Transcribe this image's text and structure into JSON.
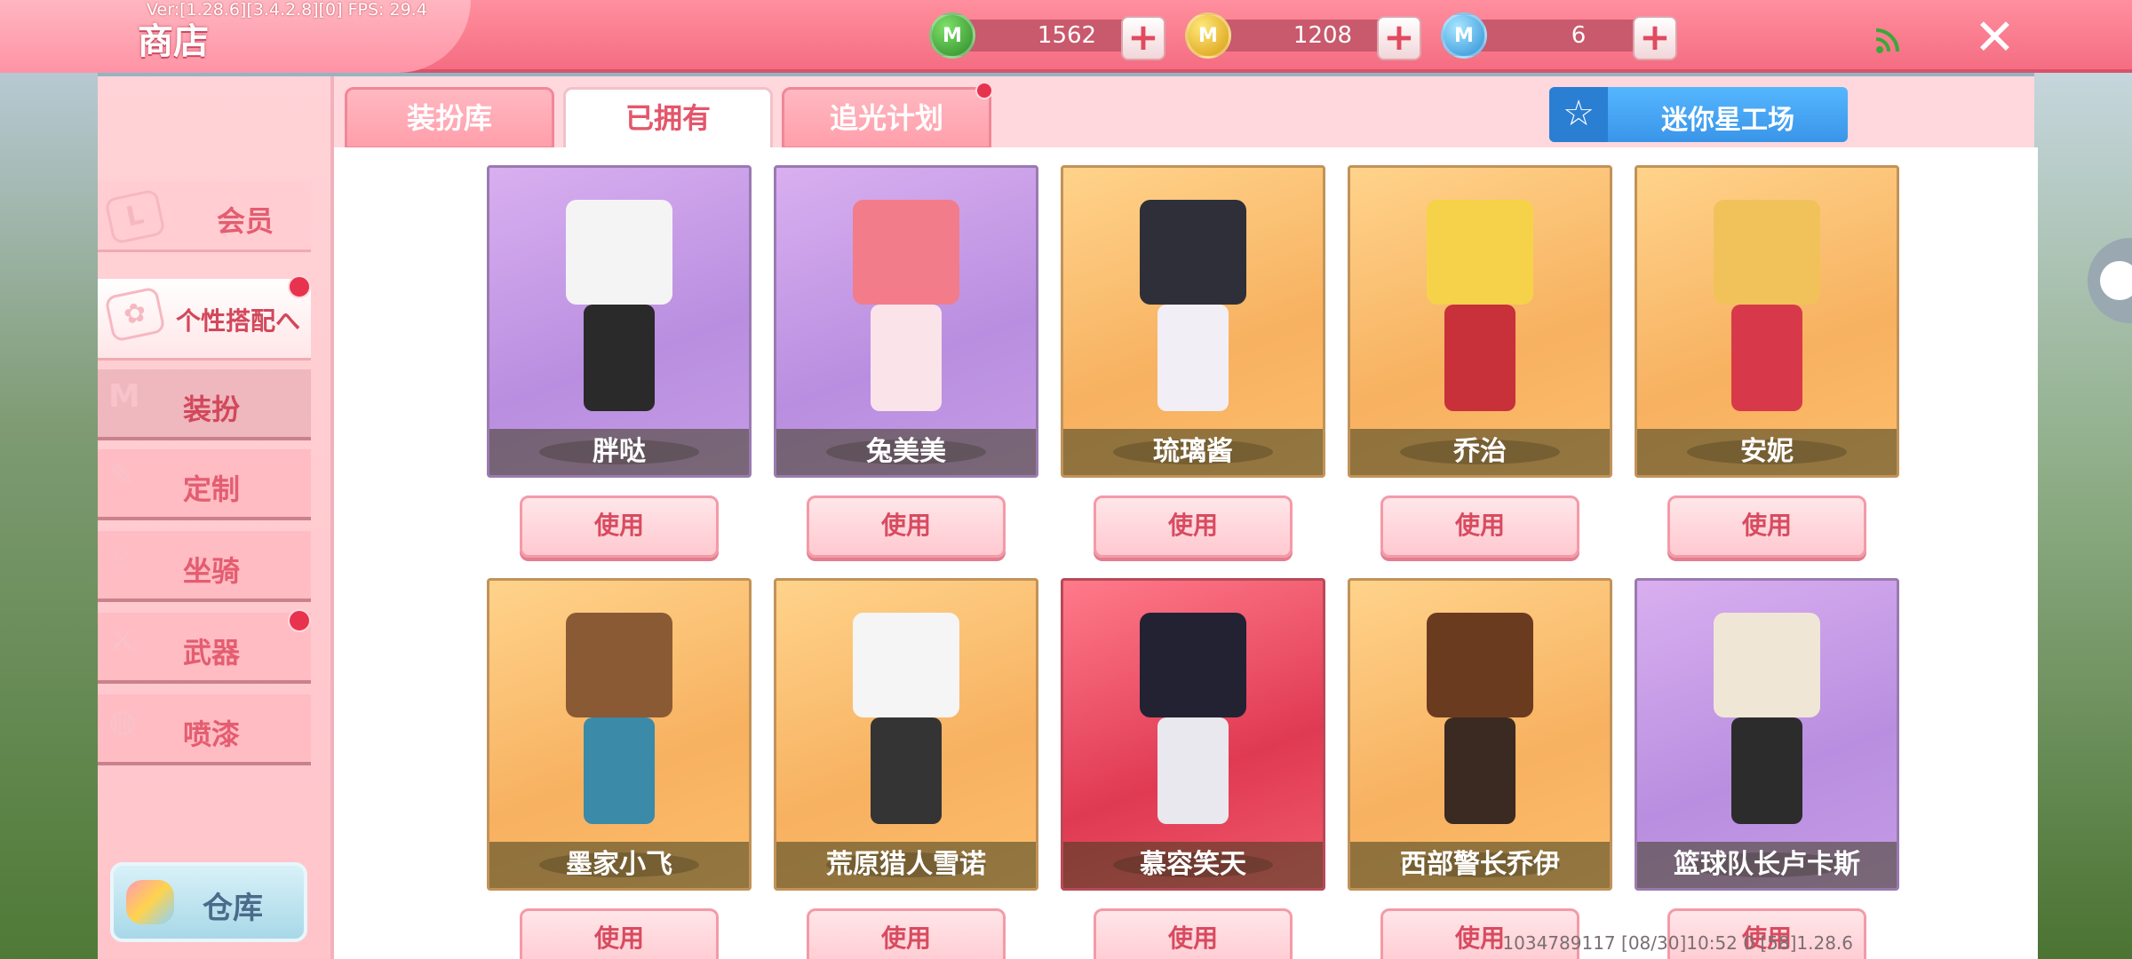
{
  "header": {
    "version": "Ver:[1.28.6][3.4.2.8][0] FPS: 29.4",
    "title": "商店",
    "currencies": [
      {
        "icon": "green-gem-icon",
        "value": "1562",
        "color": "#3fae3a"
      },
      {
        "icon": "gold-coin-icon",
        "value": "1208",
        "color": "#f3c224"
      },
      {
        "icon": "blue-star-coin-icon",
        "value": "6",
        "color": "#4fb5ef"
      }
    ],
    "close_label": "✕"
  },
  "sidebar": {
    "member": "会员",
    "outfit_group": "个性搭配へ",
    "items": [
      {
        "label": "装扮",
        "active": true
      },
      {
        "label": "定制",
        "active": false
      },
      {
        "label": "坐骑",
        "active": false
      },
      {
        "label": "武器",
        "active": false,
        "badge": true
      },
      {
        "label": "喷漆",
        "active": false
      }
    ],
    "warehouse": "仓库"
  },
  "tabs": [
    {
      "label": "装扮库",
      "active": false
    },
    {
      "label": "已拥有",
      "active": true
    },
    {
      "label": "追光计划",
      "active": false,
      "badge": true
    }
  ],
  "workshop_label": "迷你星工场",
  "cards": [
    {
      "name": "胖哒",
      "bg": "purple",
      "head": "#f4f4f4",
      "body": "#2a2a2a"
    },
    {
      "name": "兔美美",
      "bg": "purple",
      "head": "#f27c8a",
      "body": "#fbe3ea"
    },
    {
      "name": "琉璃酱",
      "bg": "orange",
      "head": "#2f2f3a",
      "body": "#f2eef6"
    },
    {
      "name": "乔治",
      "bg": "orange",
      "head": "#f6d24a",
      "body": "#c8303a"
    },
    {
      "name": "安妮",
      "bg": "orange",
      "head": "#f2c25a",
      "body": "#d8394a"
    },
    {
      "name": "墨家小飞",
      "bg": "orange",
      "head": "#8a5a34",
      "body": "#3b8aa8"
    },
    {
      "name": "荒原猎人雪诺",
      "bg": "orange",
      "head": "#f5f5f5",
      "body": "#343434"
    },
    {
      "name": "慕容笑天",
      "bg": "red",
      "head": "#222233",
      "body": "#e8e8ee"
    },
    {
      "name": "西部警长乔伊",
      "bg": "orange",
      "head": "#6b3b20",
      "body": "#3a2a22"
    },
    {
      "name": "篮球队长卢卡斯",
      "bg": "purple",
      "head": "#f0e6d6",
      "body": "#2c2c2c"
    }
  ],
  "use_label": "使用",
  "footer": "1034789117    [08/30]10:52 0  [58]1.28.6"
}
